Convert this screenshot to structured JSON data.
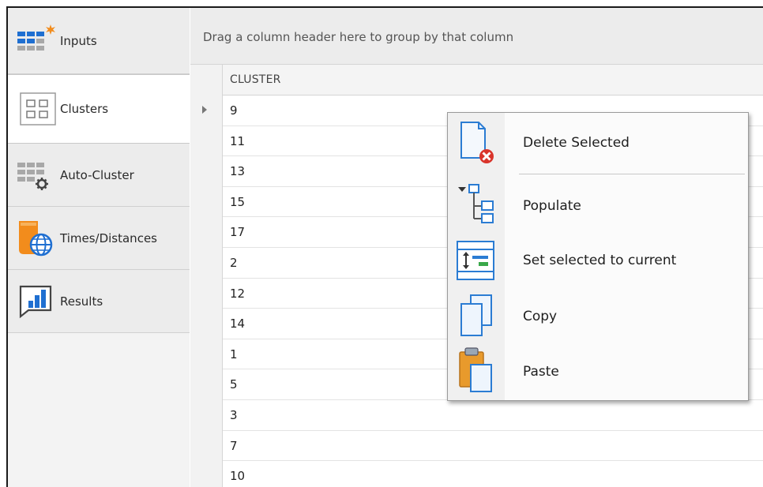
{
  "sidebar": {
    "items": [
      {
        "label": "Inputs",
        "icon": "inputs-grid-icon",
        "active": false
      },
      {
        "label": "Clusters",
        "icon": "clusters-icon",
        "active": true
      },
      {
        "label": "Auto-Cluster",
        "icon": "auto-cluster-icon",
        "active": false
      },
      {
        "label": "Times/Distances",
        "icon": "times-distances-icon",
        "active": false
      },
      {
        "label": "Results",
        "icon": "results-chart-icon",
        "active": false
      }
    ]
  },
  "grid": {
    "group_hint": "Drag a column header here to group by that column",
    "column_header": "CLUSTER",
    "rows": [
      "9",
      "11",
      "13",
      "15",
      "17",
      "2",
      "12",
      "14",
      "1",
      "5",
      "3",
      "7",
      "10"
    ]
  },
  "context_menu": {
    "items": [
      {
        "label": "Delete Selected",
        "icon": "delete-selected-icon"
      },
      {
        "label": "Populate",
        "icon": "populate-tree-icon"
      },
      {
        "label": "Set selected to current",
        "icon": "set-current-icon"
      },
      {
        "label": "Copy",
        "icon": "copy-icon"
      },
      {
        "label": "Paste",
        "icon": "paste-icon"
      }
    ]
  },
  "colors": {
    "accent_blue": "#2b7cd3",
    "icon_blue": "#1f6fd1",
    "icon_orange": "#f28c1c",
    "delete_red": "#d9342b",
    "icon_green": "#3aa84a"
  }
}
